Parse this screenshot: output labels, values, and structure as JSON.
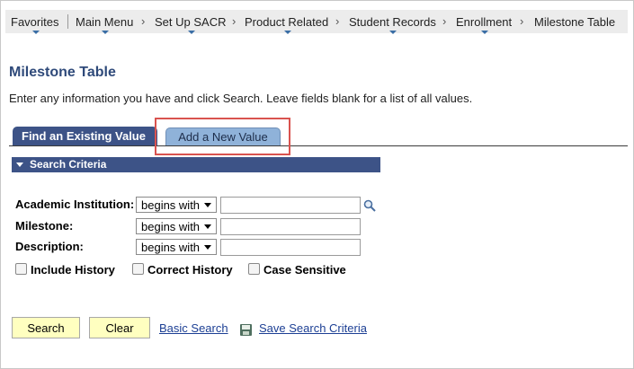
{
  "breadcrumbs": [
    {
      "label": "Favorites"
    },
    {
      "label": "Main Menu"
    },
    {
      "label": "Set Up SACR"
    },
    {
      "label": "Product Related"
    },
    {
      "label": "Student Records"
    },
    {
      "label": "Enrollment"
    },
    {
      "label": "Milestone Table"
    }
  ],
  "page": {
    "title": "Milestone Table",
    "instructions": "Enter any information you have and click Search. Leave fields blank for a list of all values."
  },
  "tabs": {
    "find_existing": "Find an Existing Value",
    "add_new": "Add a New Value"
  },
  "search_criteria": {
    "header": "Search Criteria",
    "fields": [
      {
        "label": "Academic Institution:",
        "operator": "begins with",
        "value": ""
      },
      {
        "label": "Milestone:",
        "operator": "begins with",
        "value": ""
      },
      {
        "label": "Description:",
        "operator": "begins with",
        "value": ""
      }
    ],
    "checkboxes": [
      {
        "label": "Include History",
        "checked": false
      },
      {
        "label": "Correct History",
        "checked": false
      },
      {
        "label": "Case Sensitive",
        "checked": false
      }
    ]
  },
  "actions": {
    "search": "Search",
    "clear": "Clear",
    "basic_search": "Basic Search",
    "save_criteria": "Save Search Criteria"
  },
  "colors": {
    "accent": "#3d5387",
    "button_bg": "#ffffc0",
    "highlight": "#d9534f",
    "link": "#1c3f94"
  }
}
